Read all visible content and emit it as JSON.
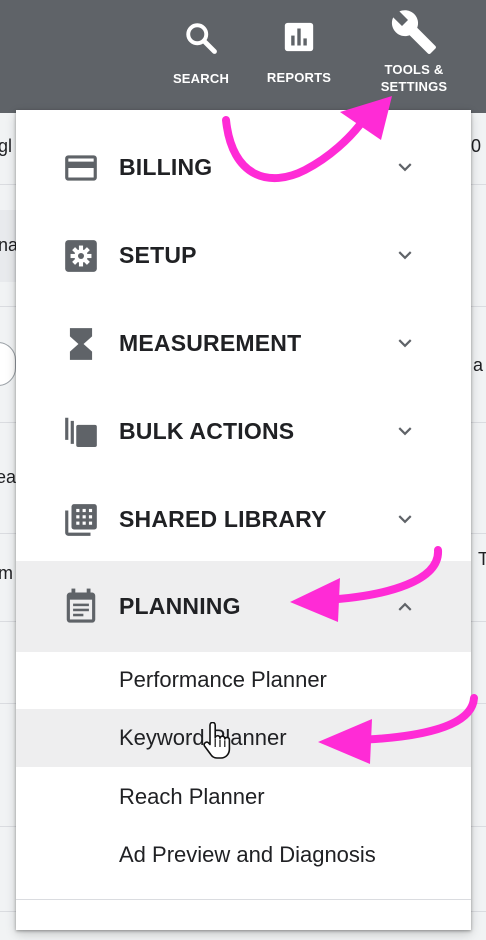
{
  "toolbar": {
    "search_label": "SEARCH",
    "reports_label": "REPORTS",
    "tools_label_line1": "TOOLS &",
    "tools_label_line2": "SETTINGS"
  },
  "background_fragments": [
    "gl",
    "na",
    "ea",
    "m",
    "a",
    "T",
    "0"
  ],
  "menu": {
    "sections": [
      {
        "label": "BILLING",
        "icon": "credit-card-icon"
      },
      {
        "label": "SETUP",
        "icon": "gear-icon"
      },
      {
        "label": "MEASUREMENT",
        "icon": "hourglass-icon"
      },
      {
        "label": "BULK ACTIONS",
        "icon": "copy-stack-icon"
      },
      {
        "label": "SHARED LIBRARY",
        "icon": "library-grid-icon"
      },
      {
        "label": "PLANNING",
        "icon": "calendar-icon",
        "expanded": true
      }
    ],
    "planning_items": [
      "Performance Planner",
      "Keyword Planner",
      "Reach Planner",
      "Ad Preview and Diagnosis"
    ],
    "highlighted_item": "Keyword Planner"
  },
  "colors": {
    "toolbar": "#5f6368",
    "icon_gray": "#5f6368",
    "annotation_arrow": "#ff2bd6",
    "hover": "#eeeeef"
  }
}
